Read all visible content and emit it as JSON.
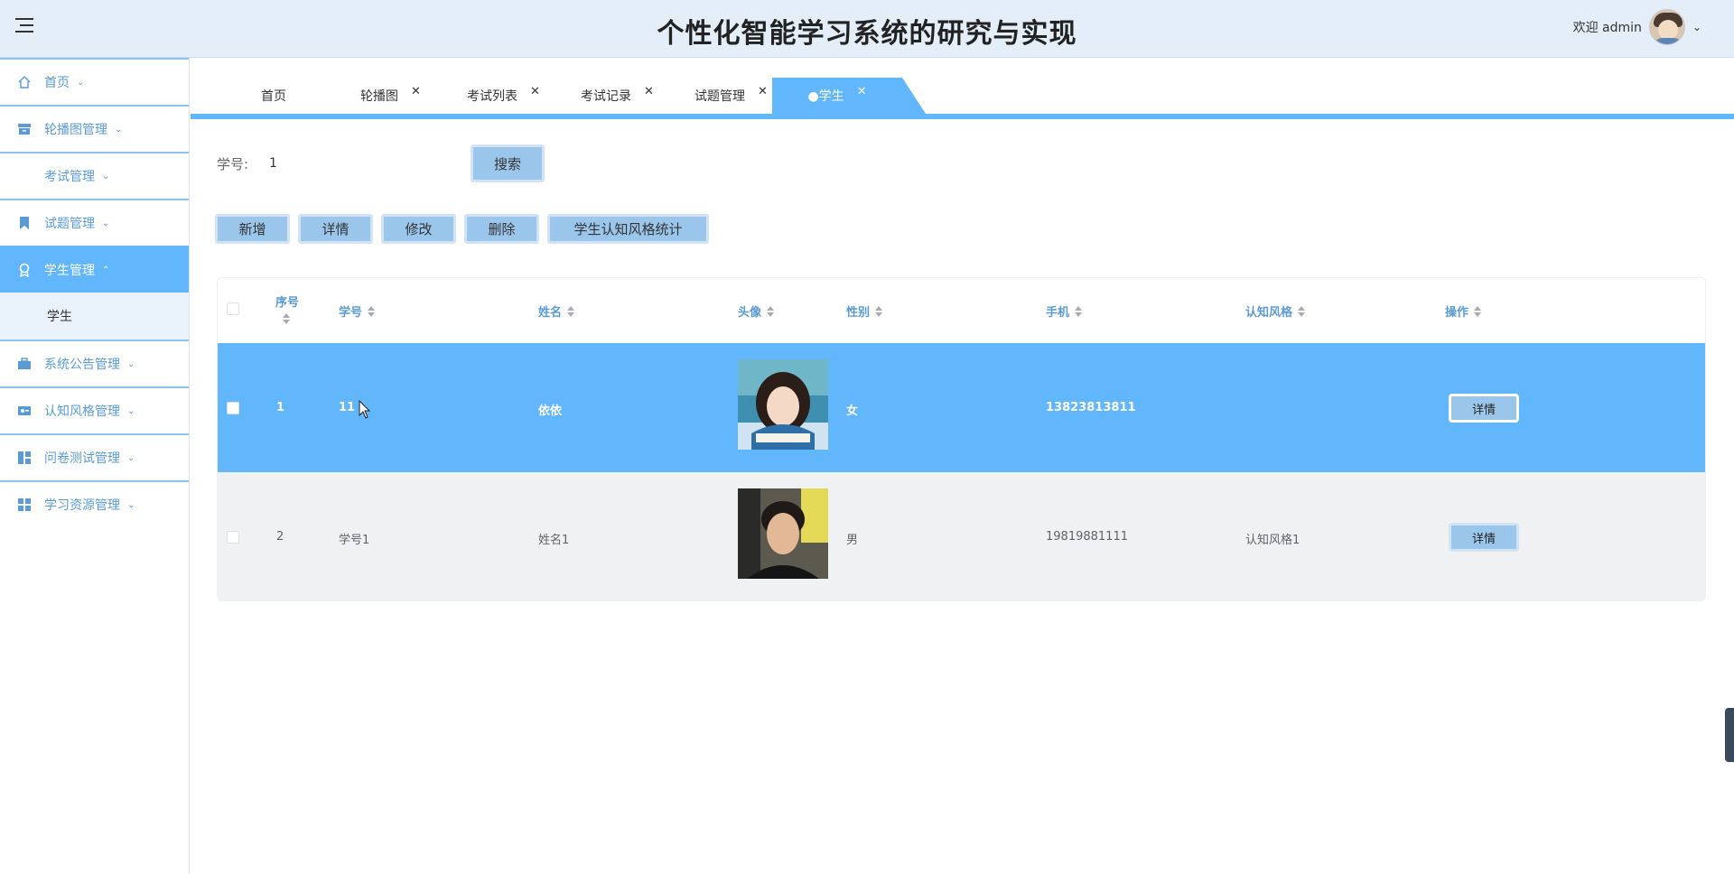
{
  "header": {
    "title": "个性化智能学习系统的研究与实现",
    "welcome": "欢迎 admin"
  },
  "sidebar": {
    "items": [
      {
        "label": "首页"
      },
      {
        "label": "轮播图管理"
      },
      {
        "label": "考试管理"
      },
      {
        "label": "试题管理"
      },
      {
        "label": "学生管理"
      },
      {
        "label": "学生"
      },
      {
        "label": "系统公告管理"
      },
      {
        "label": "认知风格管理"
      },
      {
        "label": "问卷测试管理"
      },
      {
        "label": "学习资源管理"
      }
    ]
  },
  "tabs": [
    {
      "label": "首页"
    },
    {
      "label": "轮播图"
    },
    {
      "label": "考试列表"
    },
    {
      "label": "考试记录"
    },
    {
      "label": "试题管理"
    },
    {
      "label": "●学生"
    }
  ],
  "search": {
    "label": "学号:",
    "value": "1",
    "button": "搜索"
  },
  "actions": {
    "add": "新增",
    "detail": "详情",
    "edit": "修改",
    "delete": "删除",
    "stats": "学生认知风格统计"
  },
  "table": {
    "columns": {
      "index": "序号",
      "student_no": "学号",
      "name": "姓名",
      "avatar": "头像",
      "gender": "性别",
      "phone": "手机",
      "style": "认知风格",
      "op": "操作"
    },
    "rows": [
      {
        "index": "1",
        "student_no": "11",
        "name": "依依",
        "gender": "女",
        "phone": "13823813811",
        "style": "",
        "action": "详情"
      },
      {
        "index": "2",
        "student_no": "学号1",
        "name": "姓名1",
        "gender": "男",
        "phone": "19819881111",
        "style": "认知风格1",
        "action": "详情"
      }
    ]
  },
  "colors": {
    "accent": "#62b6fc",
    "button": "#9bc6ec",
    "header_bg": "#e3eef9"
  }
}
